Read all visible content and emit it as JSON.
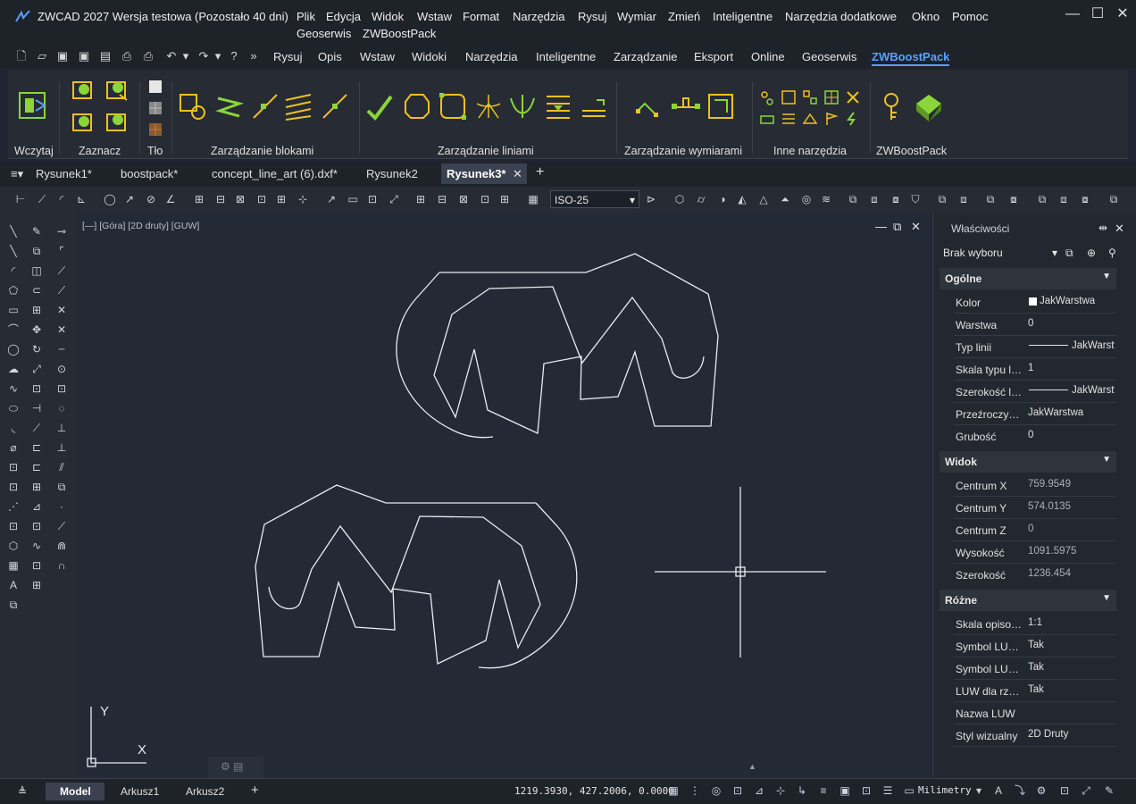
{
  "window": {
    "title": "ZWCAD 2027 Wersja testowa (Pozostało 40 dni)",
    "logo": "zw-logo-icon"
  },
  "menu": [
    "Plik",
    "Edycja",
    "Widok",
    "Wstaw",
    "Format",
    "Narzędzia",
    "Rysuj",
    "Wymiar",
    "Zmień",
    "Inteligentne",
    "Narzędzia dodatkowe",
    "Okno",
    "Pomoc"
  ],
  "menu2": [
    "Geoserwis",
    "ZWBoostPack"
  ],
  "ribbon_tabs": [
    "Rysuj",
    "Opis",
    "Wstaw",
    "Widoki",
    "Narzędzia",
    "Inteligentne",
    "Zarządzanie",
    "Eksport",
    "Online",
    "Geoserwis",
    "ZWBoostPack"
  ],
  "ribbon_active": "ZWBoostPack",
  "ribbon_groups": [
    "Wczytaj",
    "Zaznacz",
    "Tło",
    "Zarządzanie blokami",
    "Zarządzanie liniami",
    "Zarządzanie wymiarami",
    "Inne narzędzia",
    "ZWBoostPack"
  ],
  "doc_tabs": [
    "Rysunek1*",
    "boostpack*",
    "concept_line_art (6).dxf*",
    "Rysunek2",
    "Rysunek3*"
  ],
  "doc_active": "Rysunek3*",
  "dimstyle": "ISO-25",
  "viewport_label": "[—] [Góra] [2D druty] [GUW]",
  "ucs": {
    "y": "Y",
    "x": "X"
  },
  "properties": {
    "title": "Właściwości",
    "selection": "Brak wyboru",
    "sections": [
      {
        "name": "Ogólne",
        "rows": [
          {
            "name": "Kolor",
            "value": "JakWarstwa"
          },
          {
            "name": "Warstwa",
            "value": "0"
          },
          {
            "name": "Typ linii",
            "value": "JakWarstwa"
          },
          {
            "name": "Skala typu linii",
            "value": "1"
          },
          {
            "name": "Szerokość linii",
            "value": "JakWarstwa"
          },
          {
            "name": "Przeźroczystość",
            "value": "JakWarstwa"
          },
          {
            "name": "Grubość",
            "value": "0"
          }
        ]
      },
      {
        "name": "Widok",
        "rows": [
          {
            "name": "Centrum X",
            "value": "759.9549"
          },
          {
            "name": "Centrum Y",
            "value": "574.0135"
          },
          {
            "name": "Centrum Z",
            "value": "0"
          },
          {
            "name": "Wysokość",
            "value": "1091.5975"
          },
          {
            "name": "Szerokość",
            "value": "1236.454"
          }
        ]
      },
      {
        "name": "Różne",
        "rows": [
          {
            "name": "Skala opisowa",
            "value": "1:1"
          },
          {
            "name": "Symbol LUW włączony",
            "value": "Tak"
          },
          {
            "name": "Symbol LUW w początku",
            "value": "Tak"
          },
          {
            "name": "LUW dla rzutni",
            "value": "Tak"
          },
          {
            "name": "Nazwa LUW",
            "value": ""
          },
          {
            "name": "Styl wizualny",
            "value": "2D Druty"
          }
        ]
      }
    ]
  },
  "status": {
    "tabs": [
      "Model",
      "Arkusz1",
      "Arkusz2"
    ],
    "active": "Model",
    "coords": "1219.3930, 427.2006, 0.0000",
    "units": "Milimetry"
  },
  "colors": {
    "accent": "#5aa0ff",
    "ribbon_green": "#8bd53a",
    "ribbon_yellow": "#f0c020"
  }
}
